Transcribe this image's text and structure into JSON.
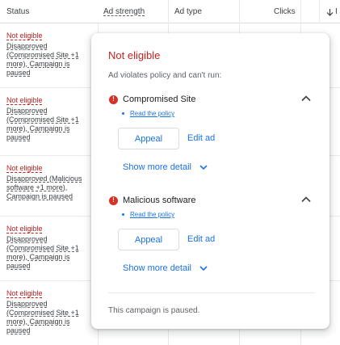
{
  "table": {
    "headers": {
      "status": "Status",
      "ad_strength": "Ad strength",
      "ad_type": "Ad type",
      "clicks": "Clicks",
      "sort_partial": "I"
    },
    "rows": [
      {
        "status": "Not eligible",
        "reason": "Disapproved (Compromised Site +1 more), Campaign is paused"
      },
      {
        "status": "Not eligible",
        "reason": "Disapproved (Compromised Site +1 more), Campaign is paused"
      },
      {
        "status": "Not eligible",
        "reason": "Disapproved (Malicious software +1 more), Campaign is paused"
      },
      {
        "status": "Not eligible",
        "reason": "Disapproved (Compromised Site +1 more), Campaign is paused"
      },
      {
        "status": "Not eligible",
        "reason": "Disapproved (Compromised Site +1 more), Campaign is paused"
      }
    ]
  },
  "popup": {
    "title": "Not eligible",
    "subtitle": "Ad violates policy and can't run:",
    "issues": [
      {
        "label": "Compromised Site",
        "policy_link": "Read the policy",
        "appeal": "Appeal",
        "edit": "Edit ad",
        "show_more": "Show more detail"
      },
      {
        "label": "Malicious software",
        "policy_link": "Read the policy",
        "appeal": "Appeal",
        "edit": "Edit ad",
        "show_more": "Show more detail"
      }
    ],
    "footer": "This campaign is paused."
  },
  "colors": {
    "error": "#c5221f",
    "link": "#1a73e8",
    "alert_icon": "#d93025"
  },
  "icons": {
    "alert": "alert-circle-icon",
    "collapse": "chevron-up-icon",
    "expand": "chevron-down-icon",
    "sort": "arrow-down-icon"
  }
}
